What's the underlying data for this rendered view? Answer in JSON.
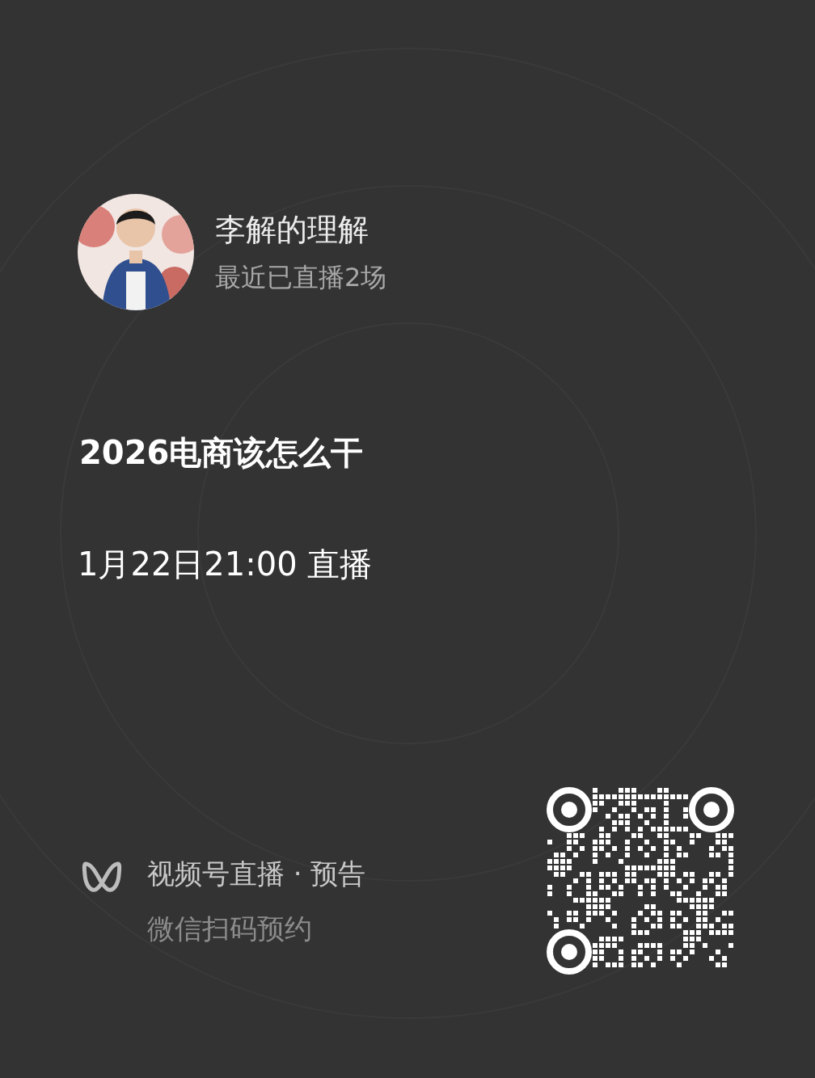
{
  "host": {
    "name": "李解的理解",
    "subtitle": "最近已直播2场"
  },
  "live": {
    "title": "2026电商该怎么干",
    "time": "1月22日21:00 直播"
  },
  "footer": {
    "brand": "视频号直播 · 预告",
    "hint": "微信扫码预约"
  }
}
